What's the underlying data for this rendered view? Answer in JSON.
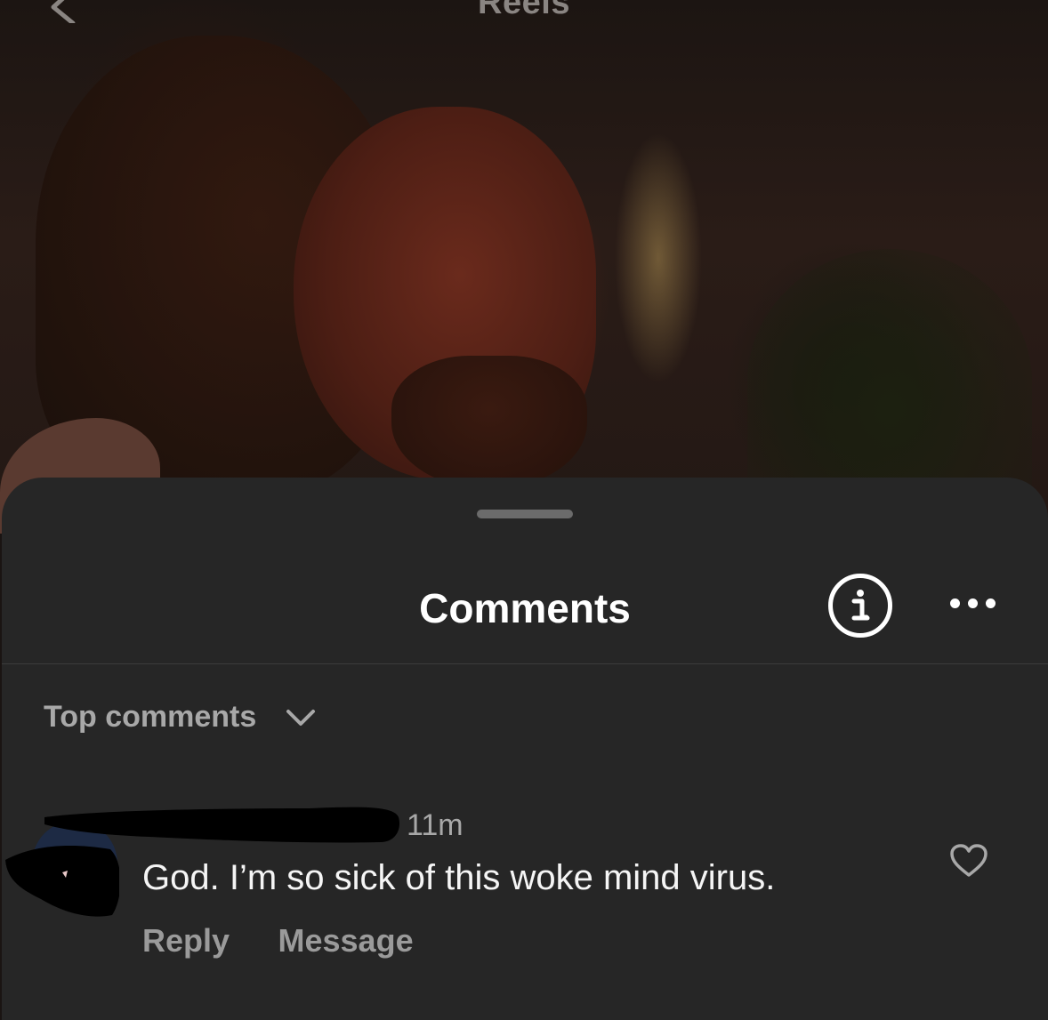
{
  "header": {
    "title": "Reels",
    "back_icon": "chevron-left-icon"
  },
  "sheet": {
    "title": "Comments",
    "info_icon": "info-circle-icon",
    "more_icon": "ellipsis-icon",
    "sort": {
      "label": "Top comments",
      "icon": "chevron-down-icon"
    }
  },
  "comments": [
    {
      "username": "",
      "username_redacted": true,
      "time": "11m",
      "text": "God. I’m so sick of this woke mind virus.",
      "reply_label": "Reply",
      "message_label": "Message",
      "like_icon": "heart-outline-icon"
    }
  ],
  "colors": {
    "sheet_bg": "#262626",
    "primary_text": "#ffffff",
    "secondary_text": "#a8a8a8"
  }
}
